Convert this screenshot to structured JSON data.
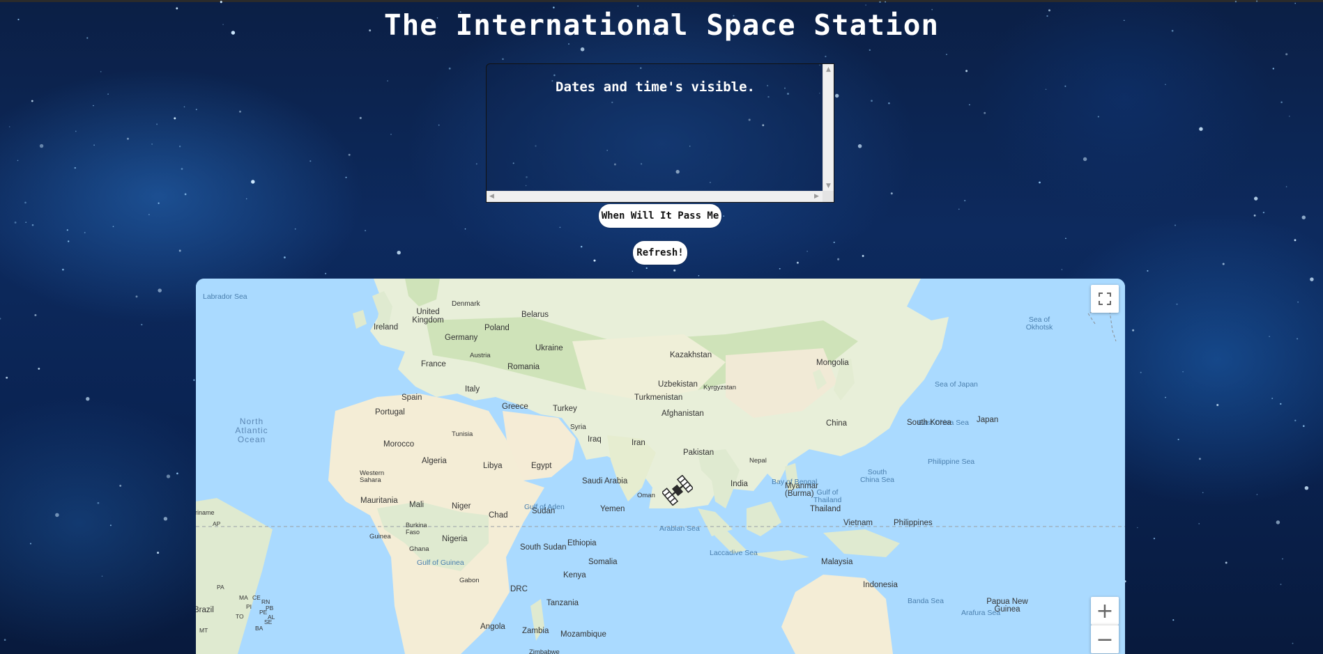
{
  "page": {
    "title": "The International Space Station"
  },
  "pass_times": {
    "heading": "Dates and time's visible."
  },
  "buttons": {
    "pass_label": "When Will It Pass Me",
    "refresh_label": "Refresh!"
  },
  "map": {
    "marker_icon": "space-station-icon",
    "controls": {
      "fullscreen_icon": "fullscreen-icon",
      "zoom_in": "+",
      "zoom_out": "−"
    },
    "labels": {
      "countries": [
        "United Kingdom",
        "Denmark",
        "Belarus",
        "Ireland",
        "Poland",
        "Germany",
        "Ukraine",
        "Austria",
        "France",
        "Romania",
        "Kazakhstan",
        "Mongolia",
        "Italy",
        "Uzbekistan",
        "Kyrgyzstan",
        "Spain",
        "Turkmenistan",
        "Portugal",
        "Greece",
        "Turkey",
        "Afghanistan",
        "China",
        "Tunisia",
        "Syria",
        "Iraq",
        "Iran",
        "South Korea",
        "Japan",
        "Morocco",
        "Algeria",
        "Libya",
        "Egypt",
        "Pakistan",
        "Nepal",
        "Western Sahara",
        "Saudi Arabia",
        "India",
        "Myanmar (Burma)",
        "Oman",
        "Mauritania",
        "Mali",
        "Niger",
        "Chad",
        "Sudan",
        "Yemen",
        "Thailand",
        "Vietnam",
        "Philippines",
        "Burkina Faso",
        "Guinea",
        "Nigeria",
        "Ethiopia",
        "Ghana",
        "South Sudan",
        "Malaysia",
        "Somalia",
        "Kenya",
        "Gabon",
        "Indonesia",
        "DRC",
        "Tanzania",
        "Papua New Guinea",
        "Angola",
        "Zambia",
        "Mozambique",
        "Brazil",
        "Zimbabwe"
      ],
      "seas": [
        "Labrador Sea",
        "Sea of Okhotsk",
        "Sea of Japan",
        "East China Sea",
        "Philippine Sea",
        "South China Sea",
        "Bay of Bengal",
        "Gulf of Thailand",
        "Gulf of Aden",
        "Arabian Sea",
        "Laccadive Sea",
        "Gulf of Guinea",
        "Banda Sea",
        "Arafura Sea"
      ],
      "oceans": [
        "North Atlantic Ocean"
      ],
      "brazil_states": [
        "AP",
        "PA",
        "MA",
        "CE",
        "RN",
        "PB",
        "PI",
        "PE",
        "AL",
        "TO",
        "SE",
        "BA",
        "MT"
      ],
      "fragment": "riname"
    }
  }
}
